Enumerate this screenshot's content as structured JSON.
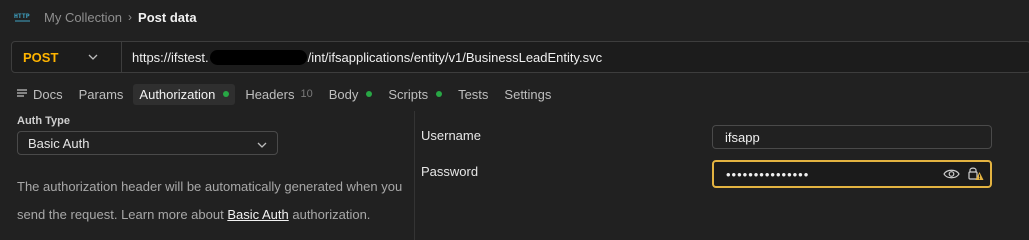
{
  "breadcrumb": {
    "icon": "http-request-icon",
    "parent": "My Collection",
    "separator": "›",
    "current": "Post data"
  },
  "request": {
    "method": "POST",
    "url_start": "https://ifstest.",
    "url_end": "/int/ifsapplications/entity/v1/BusinessLeadEntity.svc"
  },
  "tabs": [
    {
      "label": "Docs"
    },
    {
      "label": "Params"
    },
    {
      "label": "Authorization",
      "active": true,
      "indicator": "green-dot"
    },
    {
      "label": "Headers",
      "count": "10"
    },
    {
      "label": "Body",
      "indicator": "green-dot"
    },
    {
      "label": "Scripts",
      "indicator": "green-dot"
    },
    {
      "label": "Tests"
    },
    {
      "label": "Settings"
    }
  ],
  "auth": {
    "type_label": "Auth Type",
    "type_value": "Basic Auth",
    "description_pre": "The authorization header will be automatically generated when you send the request. Learn more about ",
    "description_link": "Basic Auth",
    "description_post": " authorization."
  },
  "fields": {
    "username_label": "Username",
    "username_value": "ifsapp",
    "password_label": "Password",
    "password_value": "•••••••••••••••"
  },
  "colors": {
    "method": "#ffb400",
    "focus_border": "#e3b341",
    "status_dot": "#28a745",
    "warning": "#e3b341"
  }
}
